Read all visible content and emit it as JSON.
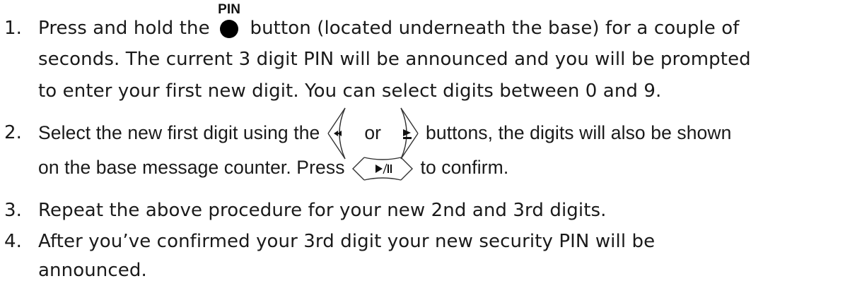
{
  "steps": [
    {
      "number": "1.",
      "lines": [
        {
          "before": "Press and hold the",
          "after": "button (located underneath the base) for a couple of"
        },
        {
          "text": "seconds. The current 3 digit PIN will be announced and you will be prompted"
        },
        {
          "text": "to enter your first new digit. You can select digits between 0 and 9."
        }
      ]
    },
    {
      "number": "2.",
      "lines": [
        {
          "before": "Select the new first digit using the",
          "middle": "or",
          "after": "buttons, the digits will also be shown"
        },
        {
          "before": "on the base message counter. Press",
          "after": "to confirm."
        }
      ]
    },
    {
      "number": "3.",
      "lines": [
        {
          "text": "Repeat the above procedure for your new 2nd and 3rd digits."
        }
      ]
    },
    {
      "number": "4.",
      "lines": [
        {
          "text": "After you’ve confirmed your 3rd digit your new security PIN will be"
        },
        {
          "text": "announced."
        }
      ]
    }
  ],
  "icons": {
    "pin_button": {
      "label": "PIN",
      "icon": "pin-button-icon",
      "color": "#000000"
    },
    "rewind_button": {
      "icon": "rewind-icon"
    },
    "forward_button": {
      "icon": "skip-forward-icon"
    },
    "play_pause_button": {
      "icon": "play-pause-icon"
    }
  }
}
